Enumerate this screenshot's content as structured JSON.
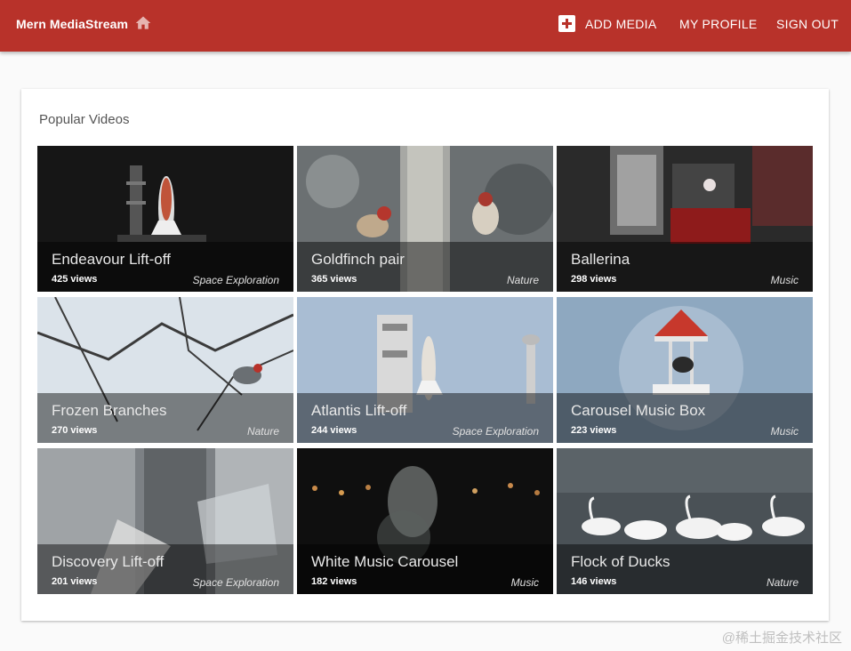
{
  "appbar": {
    "brand": "Mern MediaStream",
    "home_icon": "home-icon",
    "add_media_icon": "add-box-icon",
    "add_media_label": "ADD MEDIA",
    "profile_label": "MY PROFILE",
    "signout_label": "SIGN OUT",
    "bar_color": "#b8322a"
  },
  "main": {
    "title": "Popular Videos",
    "videos": [
      {
        "title": "Endeavour Lift-off",
        "views": "425 views",
        "genre": "Space Exploration",
        "thumb": "shuttle-night"
      },
      {
        "title": "Goldfinch pair",
        "views": "365 views",
        "genre": "Nature",
        "thumb": "birds-feeder"
      },
      {
        "title": "Ballerina",
        "views": "298 views",
        "genre": "Music",
        "thumb": "music-box"
      },
      {
        "title": "Frozen Branches",
        "views": "270 views",
        "genre": "Nature",
        "thumb": "frosty-branches"
      },
      {
        "title": "Atlantis Lift-off",
        "views": "244 views",
        "genre": "Space Exploration",
        "thumb": "shuttle-day"
      },
      {
        "title": "Carousel Music Box",
        "views": "223 views",
        "genre": "Music",
        "thumb": "carousel"
      },
      {
        "title": "Discovery Lift-off",
        "views": "201 views",
        "genre": "Space Exploration",
        "thumb": "launch-tower"
      },
      {
        "title": "White Music Carousel",
        "views": "182 views",
        "genre": "Music",
        "thumb": "bokeh-carousel"
      },
      {
        "title": "Flock of Ducks",
        "views": "146 views",
        "genre": "Nature",
        "thumb": "swans-lake"
      }
    ]
  },
  "watermark": "@稀土掘金技术社区"
}
